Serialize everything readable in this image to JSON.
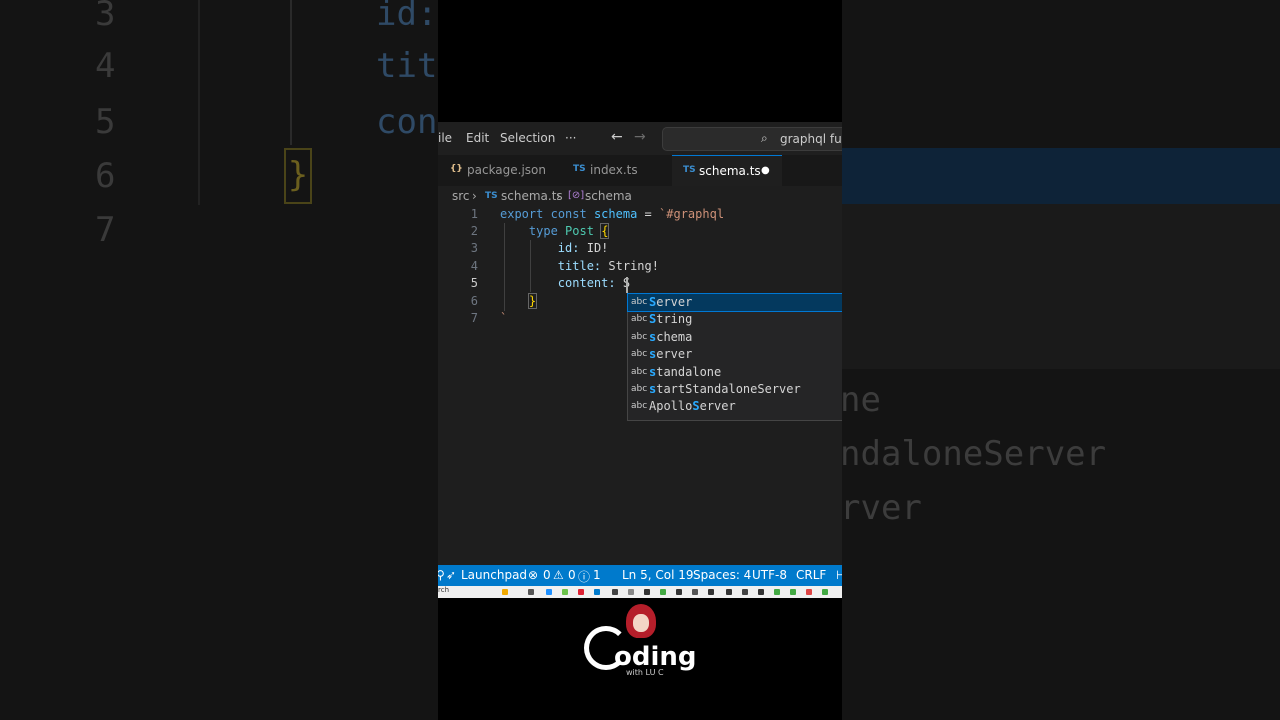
{
  "background_left": {
    "line_numbers": [
      "3",
      "4",
      "5",
      "6",
      "7"
    ],
    "code": [
      "id:",
      "tit",
      "con"
    ]
  },
  "background_right": {
    "suggestions": [
      "ne",
      "ndaloneServer",
      "rver"
    ]
  },
  "titlebar": {
    "menu": [
      "ile",
      "Edit",
      "Selection"
    ],
    "more": "···",
    "back_icon": "←",
    "forward_icon": "→",
    "search_text": "graphql fund"
  },
  "tabs": [
    {
      "icon": "{}",
      "label": "package.json",
      "active": false
    },
    {
      "icon": "TS",
      "label": "index.ts",
      "active": false
    },
    {
      "icon": "TS",
      "label": "schema.ts",
      "active": true,
      "modified_dot": "●"
    }
  ],
  "breadcrumb": {
    "folder": "src",
    "file_icon": "TS",
    "file": "schema.ts",
    "symbol": "schema"
  },
  "editor": {
    "line_numbers": [
      "1",
      "2",
      "3",
      "4",
      "5",
      "6",
      "7"
    ],
    "lines": {
      "l1": {
        "kw1": "export",
        "kw2": "const",
        "name": "schema",
        "eq": "=",
        "str": "`#graphql"
      },
      "l2": {
        "kw": "type",
        "name": "Post",
        "brace": "{"
      },
      "l3": {
        "prop": "id:",
        "type": "ID!"
      },
      "l4": {
        "prop": "title:",
        "type": "String!"
      },
      "l5": {
        "prop": "content:",
        "typed": "S"
      },
      "l6": {
        "brace": "}"
      },
      "l7": {
        "tick": "`"
      }
    }
  },
  "suggestions": [
    {
      "kind": "abc",
      "match": "S",
      "rest": "erver",
      "selected": true
    },
    {
      "kind": "abc",
      "match": "S",
      "rest": "tring",
      "selected": false
    },
    {
      "kind": "abc",
      "match": "s",
      "rest": "chema",
      "selected": false
    },
    {
      "kind": "abc",
      "match": "s",
      "rest": "erver",
      "selected": false
    },
    {
      "kind": "abc",
      "match": "s",
      "rest": "tandalone",
      "selected": false
    },
    {
      "kind": "abc",
      "match": "s",
      "rest": "tartStandaloneServer",
      "selected": false
    },
    {
      "kind": "abc",
      "prefix": "Apollo",
      "match": "S",
      "rest": "erver",
      "selected": false
    }
  ],
  "statusbar": {
    "launchpad": "Launchpad",
    "errors": "0",
    "warnings": "0",
    "info": "1",
    "position": "Ln 5, Col 19",
    "spaces": "Spaces: 4",
    "encoding": "UTF-8",
    "eol": "CRLF"
  },
  "taskbar": {
    "search": "rch"
  },
  "logo": {
    "text": "oding",
    "initial": "C",
    "subtitle": "with LU C"
  },
  "colors": {
    "accent": "#007acc",
    "selection": "#04395e",
    "keyword": "#569cd6",
    "variable": "#4fc1ff",
    "string": "#ce9178",
    "type": "#4ec9b0",
    "match": "#2aaaff"
  }
}
